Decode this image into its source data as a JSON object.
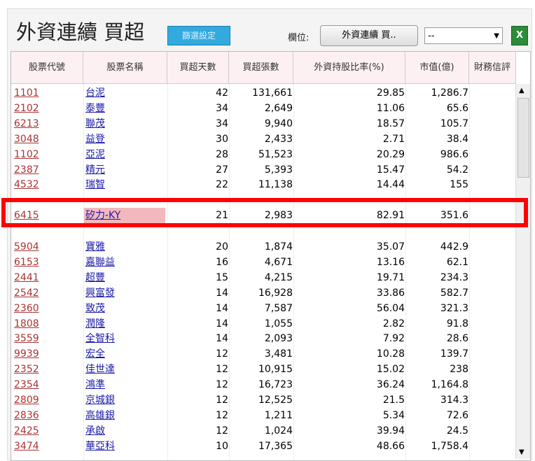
{
  "header": {
    "title": "外資連續 買超",
    "filter_button": "篩選設定",
    "column_label": "欄位:",
    "column_button": "外資連續 買..",
    "select_value": "--",
    "excel_icon": "excel-icon"
  },
  "columns": [
    "股票代號",
    "股票名稱",
    "買超天數",
    "買超張數",
    "外資持股比率(%)",
    "市值(億)",
    "財務信評"
  ],
  "rows_top": [
    [
      "1101",
      "台泥",
      "42",
      "131,661",
      "29.85",
      "1,286.7"
    ],
    [
      "2102",
      "泰豐",
      "34",
      "2,649",
      "11.06",
      "65.6"
    ],
    [
      "6213",
      "聯茂",
      "34",
      "9,940",
      "18.57",
      "105.7"
    ],
    [
      "3048",
      "益登",
      "30",
      "2,433",
      "2.71",
      "38.4"
    ],
    [
      "1102",
      "亞泥",
      "28",
      "51,523",
      "20.29",
      "986.6"
    ],
    [
      "2387",
      "精元",
      "27",
      "5,393",
      "15.47",
      "54.2"
    ],
    [
      "4532",
      "瑞智",
      "22",
      "11,138",
      "14.44",
      "155"
    ]
  ],
  "highlighted": [
    "6415",
    "矽力-KY",
    "21",
    "2,983",
    "82.91",
    "351.6"
  ],
  "rows_bottom": [
    [
      "5904",
      "寶雅",
      "20",
      "1,874",
      "35.07",
      "442.9"
    ],
    [
      "6153",
      "嘉聯益",
      "16",
      "4,671",
      "13.16",
      "62.1"
    ],
    [
      "2441",
      "超豐",
      "15",
      "4,215",
      "19.71",
      "234.3"
    ],
    [
      "2542",
      "興富發",
      "14",
      "16,928",
      "33.86",
      "582.7"
    ],
    [
      "2360",
      "致茂",
      "14",
      "7,587",
      "56.04",
      "321.3"
    ],
    [
      "1808",
      "潤隆",
      "14",
      "1,055",
      "2.82",
      "91.8"
    ],
    [
      "3559",
      "全智科",
      "14",
      "2,093",
      "7.92",
      "28.6"
    ],
    [
      "9939",
      "宏全",
      "12",
      "3,481",
      "10.28",
      "139.7"
    ],
    [
      "2352",
      "佳世達",
      "12",
      "10,915",
      "15.02",
      "238"
    ],
    [
      "2354",
      "鴻準",
      "12",
      "16,723",
      "36.24",
      "1,164.8"
    ],
    [
      "2809",
      "京城銀",
      "12",
      "12,525",
      "21.5",
      "314.3"
    ],
    [
      "2836",
      "高雄銀",
      "12",
      "1,211",
      "5.34",
      "72.6"
    ],
    [
      "2425",
      "承啟",
      "12",
      "1,024",
      "39.94",
      "24.5"
    ],
    [
      "3474",
      "華亞科",
      "10",
      "17,365",
      "48.66",
      "1,758.4"
    ]
  ],
  "colors": {
    "highlight_border": "#ff0000",
    "header_bg": "#fdf0f2",
    "button_blue": "#33aadd"
  }
}
